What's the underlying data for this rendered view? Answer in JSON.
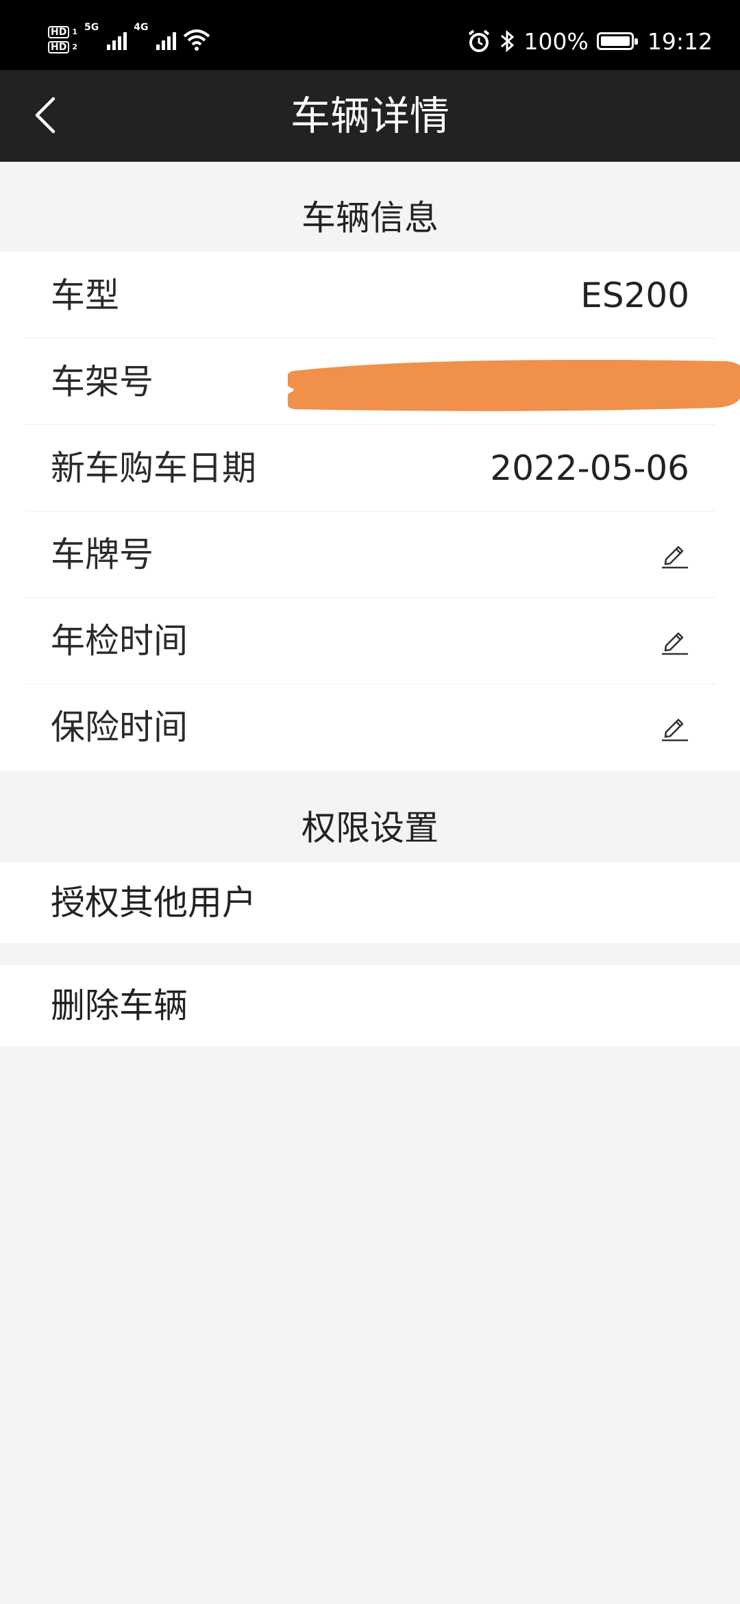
{
  "status_bar": {
    "hd1": "HD",
    "hd1_sub": "1",
    "hd2": "HD",
    "hd2_sub": "2",
    "net1": "5G",
    "net2": "4G",
    "battery_pct": "100%",
    "time": "19:12",
    "icons": [
      "alarm-icon",
      "bluetooth-icon",
      "battery-icon",
      "wifi-icon",
      "signal-icon"
    ]
  },
  "topbar": {
    "title": "车辆详情",
    "back_icon": "chevron-left-icon"
  },
  "vehicle_info": {
    "section_title": "车辆信息",
    "rows": [
      {
        "label": "车型",
        "value": "ES200"
      },
      {
        "label": "车架号",
        "value": ""
      },
      {
        "label": "新车购车日期",
        "value": "2022-05-06"
      },
      {
        "label": "车牌号",
        "value": "",
        "icon": "edit-icon"
      },
      {
        "label": "年检时间",
        "value": "",
        "icon": "edit-icon"
      },
      {
        "label": "保险时间",
        "value": "",
        "icon": "edit-icon"
      }
    ]
  },
  "permissions": {
    "section_title": "权限设置",
    "authorize_label": "授权其他用户"
  },
  "delete": {
    "label": "删除车辆"
  },
  "colors": {
    "redaction": "#f0904a",
    "topbar": "#222222",
    "background": "#f4f4f4"
  }
}
